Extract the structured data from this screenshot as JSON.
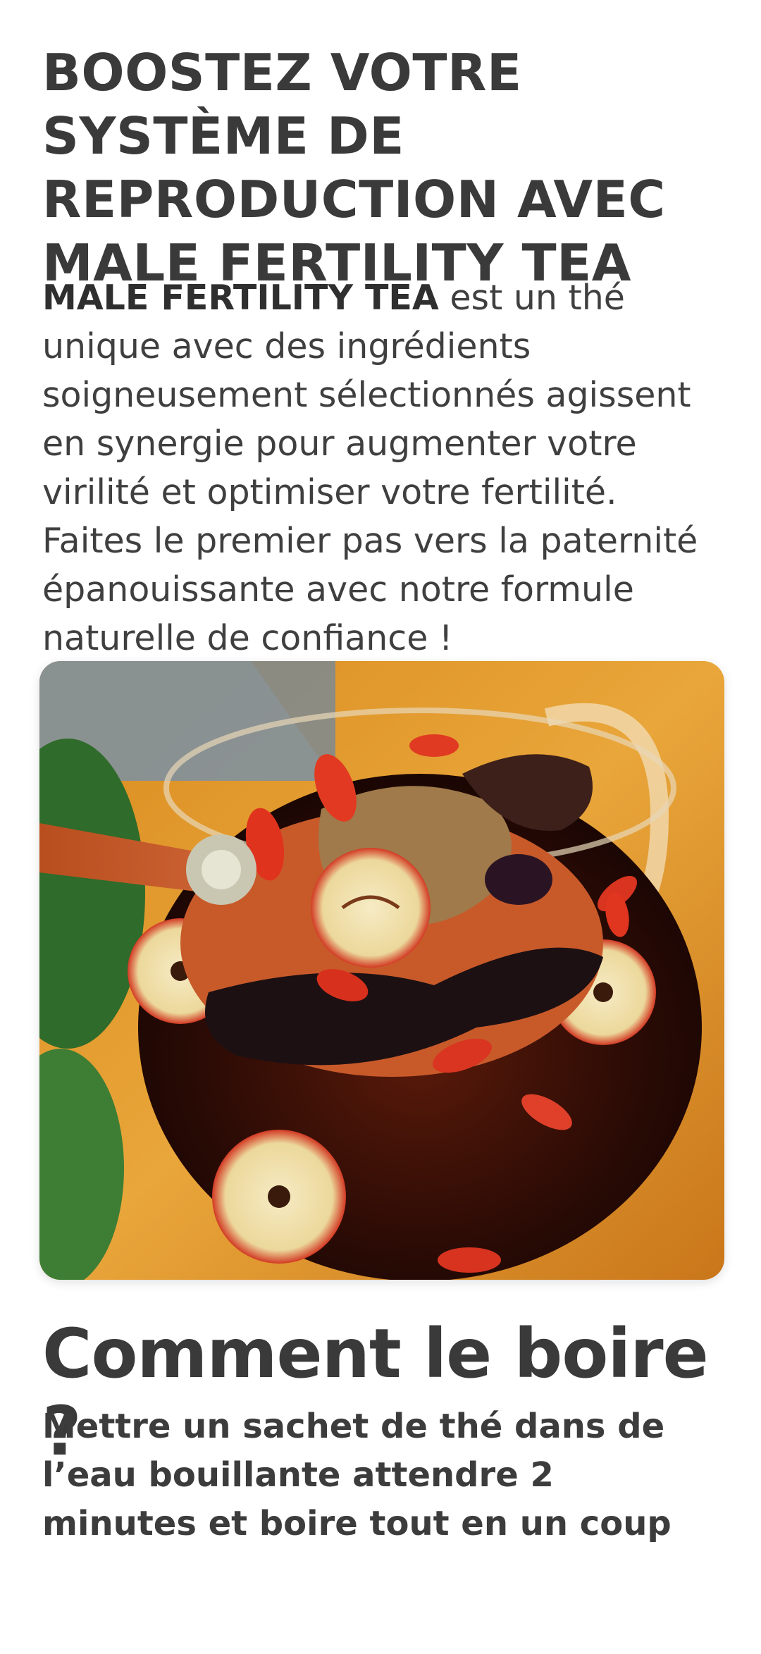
{
  "headline": "BOOSTEZ VOTRE SYSTÈME DE REPRODUCTION AVEC MALE FERTILITY TEA",
  "intro": {
    "product_name": "MALE FERTILITY TEA",
    "text": " est un thé unique avec des ingrédients soigneusement sélectionnés agissent en synergie pour augmenter votre virilité et optimiser votre fertilité. Faites le premier pas vers la paternité épanouissante avec notre formule naturelle de confiance !"
  },
  "image": {
    "subject": "tea-glass-with-goji-berries-and-herbs-on-wooden-spoon"
  },
  "how_to": {
    "title": "Comment le boire ?",
    "instructions": "Mettre un sachet de thé dans de l’eau bouillante attendre 2 minutes et boire tout en un coup"
  },
  "colors": {
    "text": "#3a3a3a",
    "background": "#ffffff"
  }
}
